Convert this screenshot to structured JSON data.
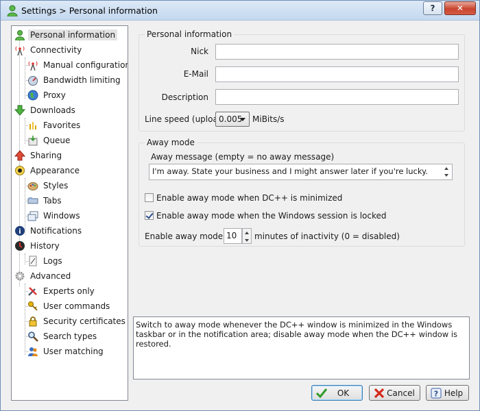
{
  "window": {
    "title": "Settings > Personal information"
  },
  "titlebar": {
    "help_label": "?",
    "close_label": "✕"
  },
  "tree": [
    {
      "label": "Personal information",
      "icon": "user-icon",
      "level": 0,
      "selected": true
    },
    {
      "label": "Connectivity",
      "icon": "antenna-icon",
      "level": 0
    },
    {
      "label": "Manual configuration",
      "icon": "antenna-config-icon",
      "level": 1
    },
    {
      "label": "Bandwidth limiting",
      "icon": "gauge-icon",
      "level": 1
    },
    {
      "label": "Proxy",
      "icon": "globe-icon",
      "level": 1
    },
    {
      "label": "Downloads",
      "icon": "download-arrow-icon",
      "level": 0
    },
    {
      "label": "Favorites",
      "icon": "favorites-icon",
      "level": 1
    },
    {
      "label": "Queue",
      "icon": "queue-icon",
      "level": 1
    },
    {
      "label": "Sharing",
      "icon": "upload-arrow-icon",
      "level": 0
    },
    {
      "label": "Appearance",
      "icon": "eye-icon",
      "level": 0
    },
    {
      "label": "Styles",
      "icon": "palette-icon",
      "level": 1
    },
    {
      "label": "Tabs",
      "icon": "tabs-icon",
      "level": 1
    },
    {
      "label": "Windows",
      "icon": "windows-icon",
      "level": 1
    },
    {
      "label": "Notifications",
      "icon": "notification-icon",
      "level": 0
    },
    {
      "label": "History",
      "icon": "clock-icon",
      "level": 0
    },
    {
      "label": "Logs",
      "icon": "log-icon",
      "level": 1
    },
    {
      "label": "Advanced",
      "icon": "gear-icon",
      "level": 0
    },
    {
      "label": "Experts only",
      "icon": "tools-icon",
      "level": 1
    },
    {
      "label": "User commands",
      "icon": "key-icon",
      "level": 1
    },
    {
      "label": "Security certificates",
      "icon": "lock-icon",
      "level": 1
    },
    {
      "label": "Search types",
      "icon": "magnifier-icon",
      "level": 1
    },
    {
      "label": "User matching",
      "icon": "users-icon",
      "level": 1
    }
  ],
  "personal": {
    "group_label": "Personal information",
    "nick_label": "Nick",
    "nick_value": "",
    "email_label": "E-Mail",
    "email_value": "",
    "description_label": "Description",
    "description_value": "",
    "line_speed_label": "Line speed (upload)",
    "line_speed_value": "0.005",
    "line_speed_unit": "MiBits/s"
  },
  "away": {
    "group_label": "Away mode",
    "message_label": "Away message (empty = no away message)",
    "message_value": "I'm away. State your business and I might answer later if you're lucky.",
    "minimized_label": "Enable away mode when DC++ is minimized",
    "minimized_checked": false,
    "locked_label": "Enable away mode when the Windows session is locked",
    "locked_checked": true,
    "after_prefix": "Enable away mode after",
    "after_value": "10",
    "after_suffix": "minutes of inactivity (0 = disabled)"
  },
  "description_text": "Switch to away mode whenever the DC++ window is minimized in the Windows taskbar or in the notification area; disable away mode when the DC++ window is restored.",
  "buttons": {
    "ok": "OK",
    "cancel": "Cancel",
    "help": "Help"
  }
}
